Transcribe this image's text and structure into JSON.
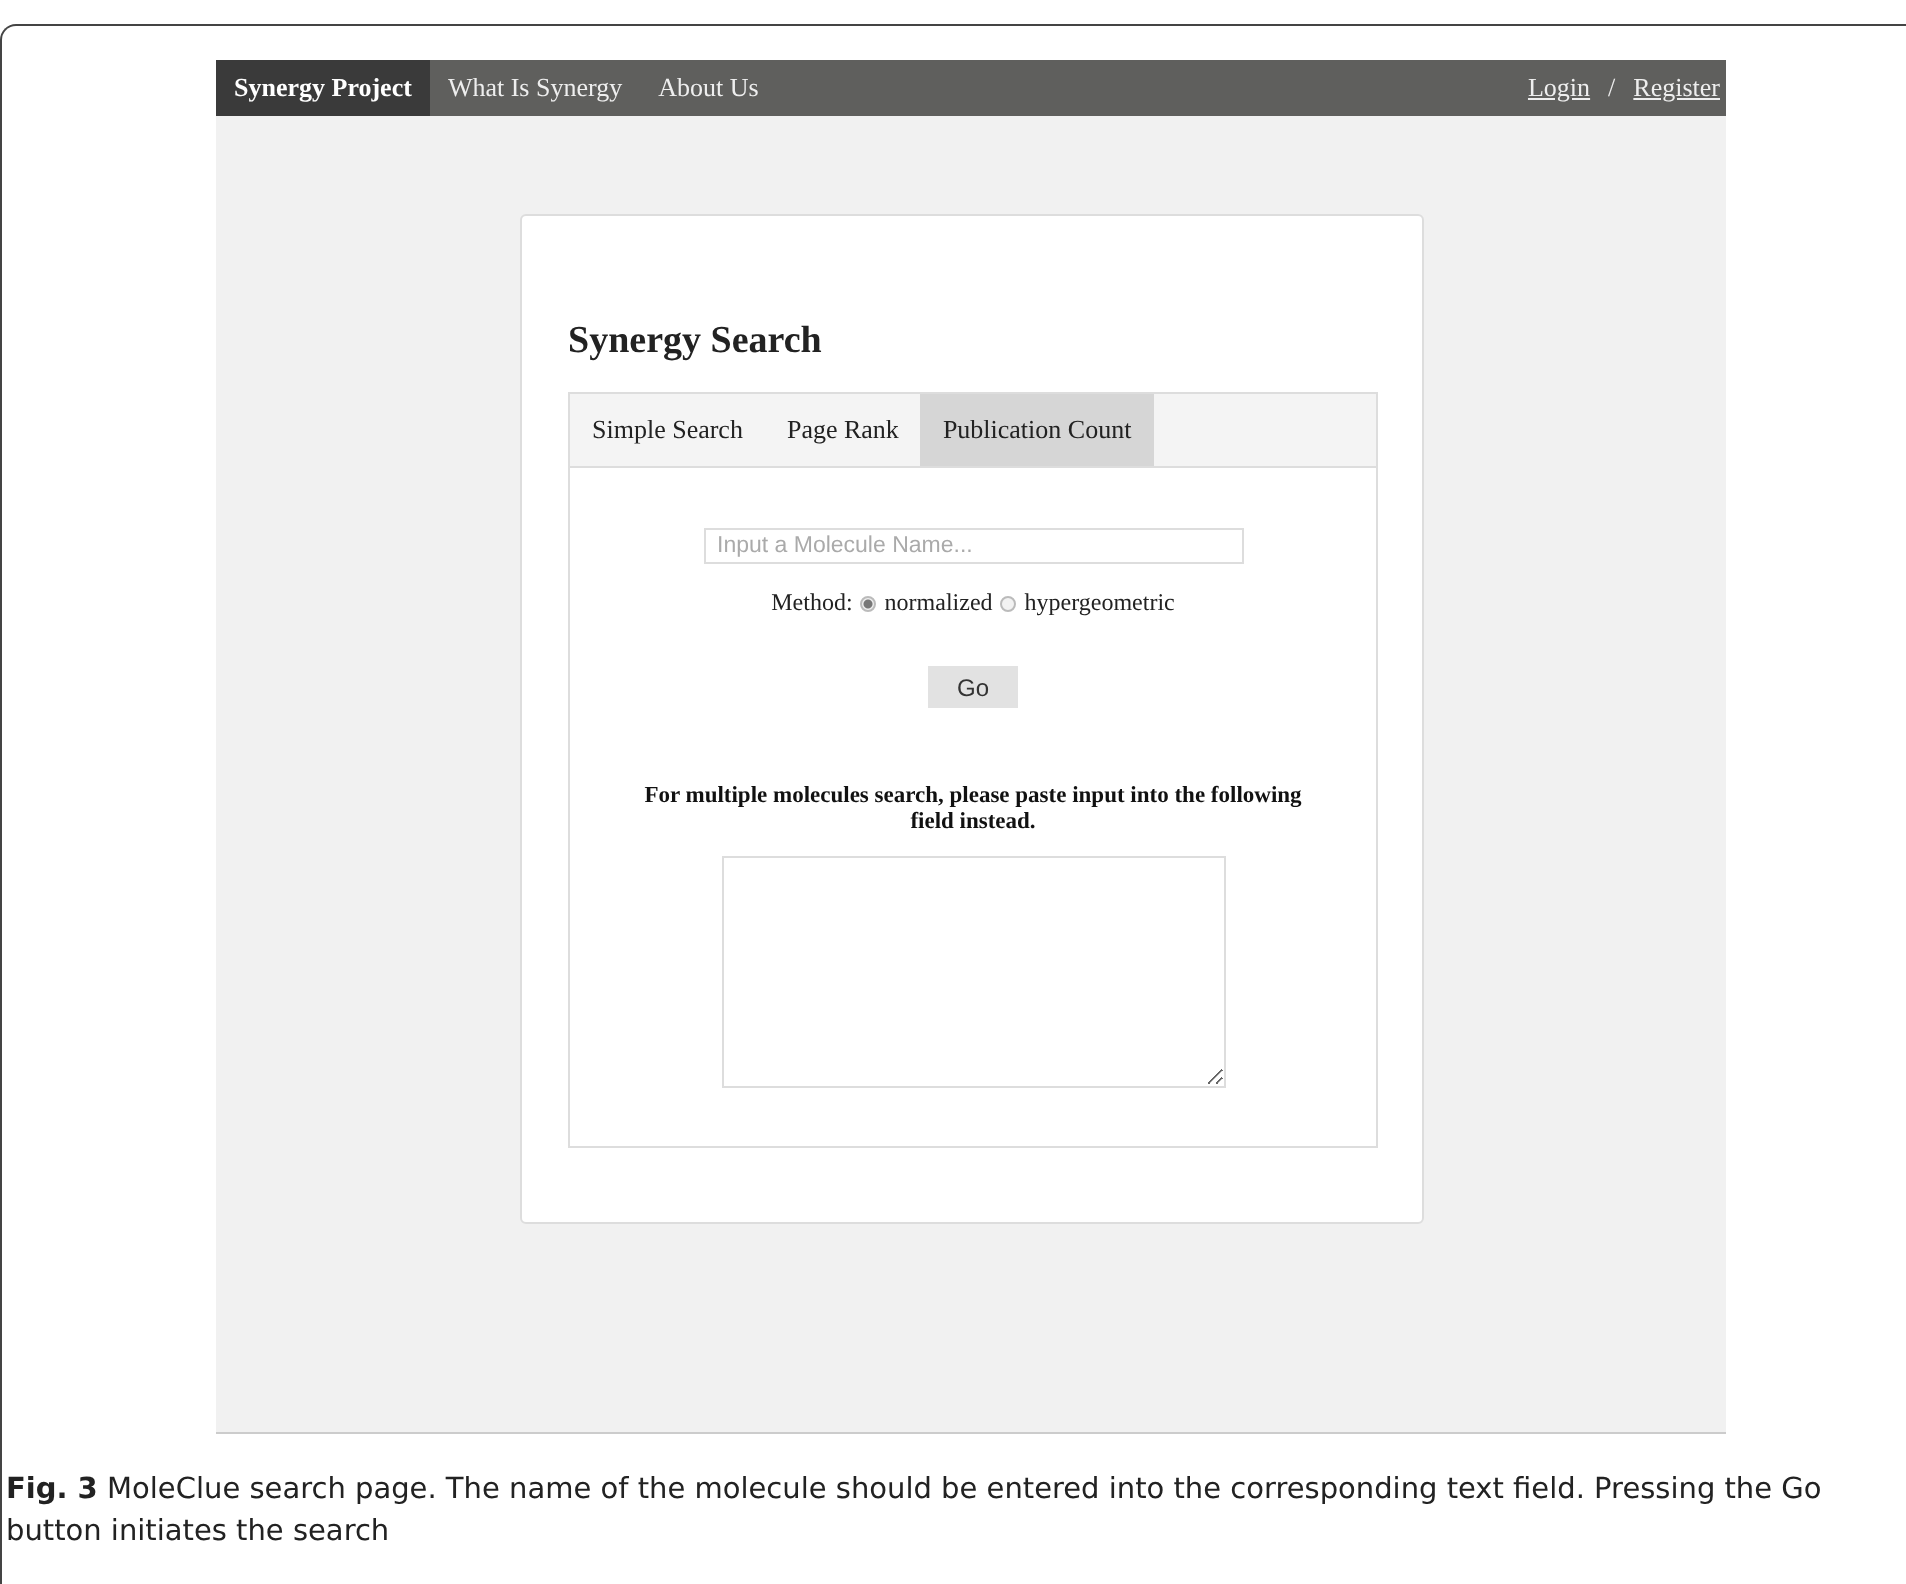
{
  "navbar": {
    "items": [
      {
        "label": "Synergy Project",
        "selected": true
      },
      {
        "label": "What Is Synergy",
        "selected": false
      },
      {
        "label": "About Us",
        "selected": false
      }
    ],
    "login": "Login",
    "separator": "/",
    "register": "Register"
  },
  "card": {
    "title": "Synergy Search",
    "tabs": [
      {
        "label": "Simple Search",
        "selected": false
      },
      {
        "label": "Page Rank",
        "selected": false
      },
      {
        "label": "Publication Count",
        "selected": true
      }
    ],
    "search": {
      "placeholder": "Input a Molecule Name..."
    },
    "method_label": "Method:",
    "methods": [
      {
        "label": "normalized",
        "selected": true
      },
      {
        "label": "hypergeometric",
        "selected": false
      }
    ],
    "go_button": "Go",
    "multi_note": "For multiple molecules search, please paste input into the following field instead."
  },
  "caption": "**Fig. 3**  MoleClue search page. The name of the molecule should be entered into the corresponding text field. Pressing the Go button initiates the search"
}
